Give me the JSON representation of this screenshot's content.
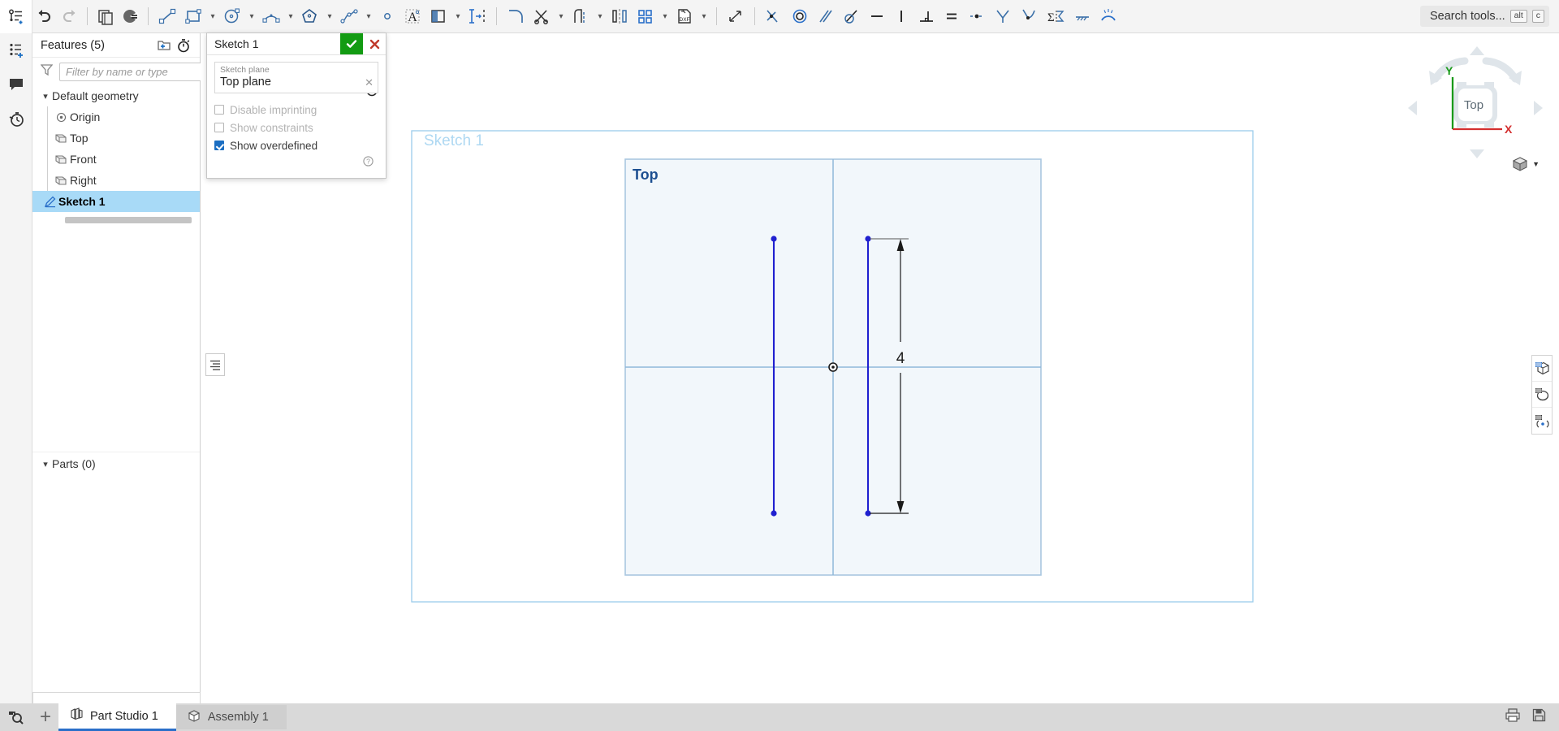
{
  "app": {
    "name": "Onshape Part Studio"
  },
  "toolbar": {
    "items": [
      {
        "name": "feature-list-icon",
        "label": "Feature list"
      },
      {
        "name": "undo-icon",
        "label": "Undo"
      },
      {
        "name": "redo-icon",
        "label": "Redo"
      },
      {
        "name": "copy-icon",
        "label": "Copy"
      },
      {
        "name": "paste-icon",
        "label": "Paste"
      },
      {
        "name": "line-icon",
        "label": "Line"
      },
      {
        "name": "rectangle-icon",
        "label": "Corner rectangle"
      },
      {
        "name": "circle-icon",
        "label": "Circle"
      },
      {
        "name": "arc-icon",
        "label": "Arc"
      },
      {
        "name": "polygon-icon",
        "label": "Polygon"
      },
      {
        "name": "spline-icon",
        "label": "Spline"
      },
      {
        "name": "point-icon",
        "label": "Point"
      },
      {
        "name": "text-icon",
        "label": "Text"
      },
      {
        "name": "use-projection-icon",
        "label": "Use (project/convert)"
      },
      {
        "name": "offset-icon",
        "label": "Offset"
      },
      {
        "name": "fillet-icon",
        "label": "Sketch fillet"
      },
      {
        "name": "trim-icon",
        "label": "Trim"
      },
      {
        "name": "extend-icon",
        "label": "Extend"
      },
      {
        "name": "mirror-icon",
        "label": "Mirror"
      },
      {
        "name": "linear-pattern-icon",
        "label": "Linear pattern"
      },
      {
        "name": "dxf-import-icon",
        "label": "Import DXF"
      },
      {
        "name": "dimension-icon",
        "label": "Dimension"
      },
      {
        "name": "coincident-icon",
        "label": "Coincident"
      },
      {
        "name": "concentric-icon",
        "label": "Concentric"
      },
      {
        "name": "parallel-icon",
        "label": "Parallel"
      },
      {
        "name": "tangent-icon",
        "label": "Tangent"
      },
      {
        "name": "horizontal-icon",
        "label": "Horizontal"
      },
      {
        "name": "vertical-icon",
        "label": "Vertical"
      },
      {
        "name": "perpendicular-icon",
        "label": "Perpendicular"
      },
      {
        "name": "equal-icon",
        "label": "Equal"
      },
      {
        "name": "midpoint-icon",
        "label": "Midpoint"
      },
      {
        "name": "symmetric-icon",
        "label": "Symmetric"
      },
      {
        "name": "curvature-icon",
        "label": "Curvature"
      },
      {
        "name": "construction-icon",
        "label": "Construction"
      },
      {
        "name": "fix-icon",
        "label": "Fix"
      },
      {
        "name": "normal-icon",
        "label": "Normal"
      }
    ]
  },
  "search": {
    "placeholder": "Search tools...",
    "shortcut_alt": "alt",
    "shortcut_key": "c"
  },
  "rail": {
    "items": [
      {
        "name": "rail-item-feature-list",
        "label": "Feature list"
      },
      {
        "name": "rail-item-comments",
        "label": "Comments"
      },
      {
        "name": "rail-item-history",
        "label": "History"
      }
    ]
  },
  "tree": {
    "title": "Features (5)",
    "add_folder_label": "Add folder",
    "rollback_label": "Rollback",
    "filter_placeholder": "Filter by name or type",
    "filter_value": "",
    "filter_icon_label": "Filter",
    "nodes": [
      {
        "label": "Default geometry",
        "icon": "chevron-down-icon",
        "level": 0,
        "selected": false
      },
      {
        "label": "Origin",
        "icon": "origin-icon",
        "level": 1,
        "selected": false
      },
      {
        "label": "Top",
        "icon": "plane-icon",
        "level": 1,
        "selected": false
      },
      {
        "label": "Front",
        "icon": "plane-icon",
        "level": 1,
        "selected": false
      },
      {
        "label": "Right",
        "icon": "plane-icon",
        "level": 1,
        "selected": false
      },
      {
        "label": "Sketch 1",
        "icon": "sketch-icon",
        "level": 0,
        "selected": true
      }
    ],
    "parts_label": "Parts (0)"
  },
  "dialog": {
    "title": "Sketch 1",
    "accept_label": "Accept",
    "cancel_label": "Cancel",
    "history_label": "Feature history",
    "help_label": "Help",
    "plane": {
      "label": "Sketch plane",
      "value": "Top plane",
      "clear_label": "Clear selection"
    },
    "checkboxes": [
      {
        "label": "Disable imprinting",
        "checked": false,
        "disabled": true
      },
      {
        "label": "Show constraints",
        "checked": false,
        "disabled": true
      },
      {
        "label": "Show overdefined",
        "checked": true,
        "disabled": false
      }
    ]
  },
  "canvas": {
    "sketch_label": "Sketch 1",
    "plane_label": "Top",
    "dimension_value": "4",
    "colors": {
      "sketch_label": "#aed8f2",
      "plane_fill": "#f2f7fb",
      "plane_border": "#a9c7e0",
      "plane_label": "#1d4f91",
      "sketch_line": "#2020d0",
      "dimension": "#1a1a1a",
      "bounds_border": "#9ccbec"
    }
  },
  "viewcube": {
    "face_label": "Top",
    "axis_x": "X",
    "axis_y": "Y",
    "axis_x_color": "#d32f2f",
    "axis_y_color": "#1a9a1a",
    "display_mode_label": "Display mode"
  },
  "right_tools": {
    "items": [
      {
        "name": "sketch-display-icon",
        "label": "Sketch display"
      },
      {
        "name": "sketch-rotate-icon",
        "label": "Sketch view orientation"
      },
      {
        "name": "sketch-constraints-icon",
        "label": "Sketch constraint filter"
      }
    ]
  },
  "bottom": {
    "search_label": "Search document",
    "add_tab_label": "Add tab",
    "tabs": [
      {
        "label": "Part Studio 1",
        "icon": "part-studio-icon",
        "active": true
      },
      {
        "label": "Assembly 1",
        "icon": "assembly-icon",
        "active": false
      }
    ],
    "right_icons": [
      {
        "name": "print-icon",
        "label": "Print"
      },
      {
        "name": "save-icon",
        "label": "Save"
      }
    ]
  }
}
